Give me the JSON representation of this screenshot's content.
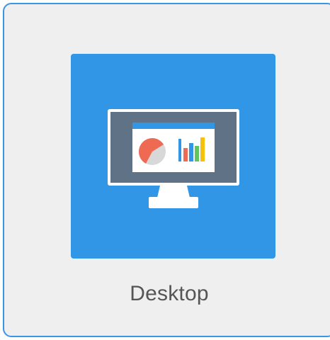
{
  "tile": {
    "label": "Desktop",
    "icon": "desktop-monitor-icon",
    "selected": true
  },
  "colors": {
    "tile_background": "#efefef",
    "tile_border": "#3b94e6",
    "icon_background": "#3196e6",
    "monitor_frame": "#ffffff",
    "monitor_screen": "#607386",
    "chart_pie_red": "#ef6a52",
    "chart_pie_grey": "#d8d8d8",
    "chart_bar_red": "#ef6a52",
    "chart_bar_blue": "#3196e6",
    "chart_bar_green": "#62c45c",
    "chart_bar_yellow": "#f4c20d",
    "label_text": "#555555"
  }
}
